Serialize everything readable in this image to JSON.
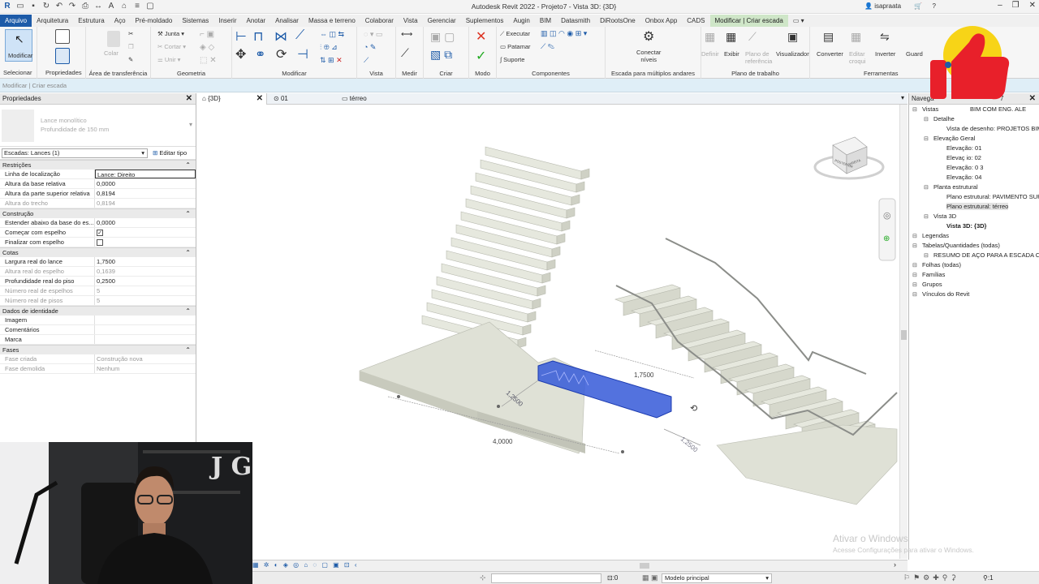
{
  "window": {
    "title": "Autodesk Revit 2022 - Projeto7 - Vista 3D: {3D}",
    "user": "isapraata"
  },
  "ribbon_tabs": [
    "Arquivo",
    "Arquitetura",
    "Estrutura",
    "Aço",
    "Pré-moldado",
    "Sistemas",
    "Inserir",
    "Anotar",
    "Analisar",
    "Massa e terreno",
    "Colaborar",
    "Vista",
    "Gerenciar",
    "Suplementos",
    "Augin",
    "BIM",
    "Datasmith",
    "DiRootsOne",
    "Onbox App",
    "CADS",
    "Modificar | Criar escada"
  ],
  "ribbon": {
    "modificar": "Modificar",
    "selecionar": "Selecionar",
    "propriedades": "Propriedades",
    "area_transferencia": "Área de transferência",
    "colar": "Colar",
    "junta": "Junta",
    "cortar": "Cortar",
    "unir": "Unir",
    "geometria": "Geometria",
    "modificar_panel": "Modificar",
    "vista": "Vista",
    "medir": "Medir",
    "criar": "Criar",
    "modo": "Modo",
    "executar": "Executar",
    "patamar": "Patamar",
    "suporte": "Suporte",
    "componentes": "Componentes",
    "conectar_niveis": "Conectar\nníveis",
    "escada_multiplos": "Escada para múltiplos andares",
    "definir": "Definir",
    "exibir": "Exibir",
    "plano_referencia": "Plano de\nreferência",
    "visualizador": "Visualizador",
    "plano_trabalho": "Plano de trabalho",
    "converter": "Converter",
    "editar_croqui": "Editar\ncroqui",
    "inverter": "Inverter",
    "guard": "Guard",
    "ferramentas": "Ferramentas"
  },
  "context_bar": "Modificar | Criar escada",
  "properties": {
    "title": "Propriedades",
    "type_name": "Lance monolítico",
    "type_sub": "Profundidade de 150 mm",
    "selector": "Escadas: Lances (1)",
    "edit_type": "Editar tipo",
    "groups": [
      {
        "name": "Restrições",
        "rows": [
          {
            "k": "Linha de localização",
            "v": "Lance: Direito",
            "boxed": true
          },
          {
            "k": "Altura da base relativa",
            "v": "0,0000"
          },
          {
            "k": "Altura da parte superior relativa",
            "v": "0,8194"
          },
          {
            "k": "Altura do trecho",
            "v": "0,8194",
            "dim": true
          }
        ]
      },
      {
        "name": "Construção",
        "rows": [
          {
            "k": "Estender abaixo da base do es...",
            "v": "0,0000"
          },
          {
            "k": "Começar com espelho",
            "v": "✓",
            "check": true
          },
          {
            "k": "Finalizar com espelho",
            "v": "",
            "check": true
          }
        ]
      },
      {
        "name": "Cotas",
        "rows": [
          {
            "k": "Largura real do lance",
            "v": "1,7500"
          },
          {
            "k": "Altura real do espelho",
            "v": "0,1639",
            "dim": true
          },
          {
            "k": "Profundidade real do piso",
            "v": "0,2500"
          },
          {
            "k": "Número real de espelhos",
            "v": "5",
            "dim": true
          },
          {
            "k": "Número real de pisos",
            "v": "5",
            "dim": true
          }
        ]
      },
      {
        "name": "Dados de identidade",
        "rows": [
          {
            "k": "Imagem",
            "v": ""
          },
          {
            "k": "Comentários",
            "v": ""
          },
          {
            "k": "Marca",
            "v": ""
          }
        ]
      },
      {
        "name": "Fases",
        "rows": [
          {
            "k": "Fase criada",
            "v": "Construção nova",
            "dim": true
          },
          {
            "k": "Fase demolida",
            "v": "Nenhum",
            "dim": true
          }
        ]
      }
    ]
  },
  "view_tabs": {
    "t1": "{3D}",
    "t2": "01",
    "t3": "térreo"
  },
  "viewcube": {
    "face1": "POSTERIOR",
    "face2": "DIREITA"
  },
  "dimensions": {
    "d1": "4,0000",
    "d2": "1,2500",
    "d3": "1,7500",
    "d4": "1,2500"
  },
  "browser": {
    "header": "Navega",
    "header2": "7",
    "items": [
      {
        "t": "Vistas",
        "t2": "BIM COM ENG. ALE",
        "lvl": 0
      },
      {
        "t": "Detalhe",
        "lvl": 1
      },
      {
        "t": "Vista de desenho: PROJETOS BIM",
        "lvl": 2
      },
      {
        "t": "Elevação Geral",
        "lvl": 1
      },
      {
        "t": "Elevação: 01",
        "lvl": 2
      },
      {
        "t": "Elevaç io: 02",
        "lvl": 2
      },
      {
        "t": "Elevação: 0 3",
        "lvl": 2
      },
      {
        "t": "Elevação: 04",
        "lvl": 2
      },
      {
        "t": "Planta estrutural",
        "lvl": 1
      },
      {
        "t": "Plano estrutural: PAVIMENTO SUP",
        "lvl": 2
      },
      {
        "t": "Plano estrutural: térreo",
        "lvl": 2,
        "sel": true
      },
      {
        "t": "Vista 3D",
        "lvl": 1
      },
      {
        "t": "Vista 3D: {3D}",
        "lvl": 2,
        "bold": true
      },
      {
        "t": "Legendas",
        "lvl": 0
      },
      {
        "t": "Tabelas/Quantidades (todas)",
        "lvl": 0
      },
      {
        "t": "RESUMO DE AÇO PARA A ESCADA  C",
        "lvl": 1
      },
      {
        "t": "Folhas (todas)",
        "lvl": 0
      },
      {
        "t": "Famílias",
        "lvl": 0
      },
      {
        "t": "Grupos",
        "lvl": 0
      },
      {
        "t": "Vínculos do Revit",
        "lvl": 0
      }
    ]
  },
  "statusbar": {
    "count": ":0",
    "model": "Modelo principal",
    "sel": ":1"
  },
  "watermark": {
    "line1": "Ativar o Windows",
    "line2": "Acesse Configurações para ativar o Windows."
  },
  "colors": {
    "accent": "#1d5ba8",
    "context_tab": "#cfe6c8",
    "selection_blue": "#2a4fd6",
    "thumbs_red": "#e8202a",
    "thumbs_yellow": "#f7d417"
  },
  "webcam": {
    "letters": "J G"
  }
}
